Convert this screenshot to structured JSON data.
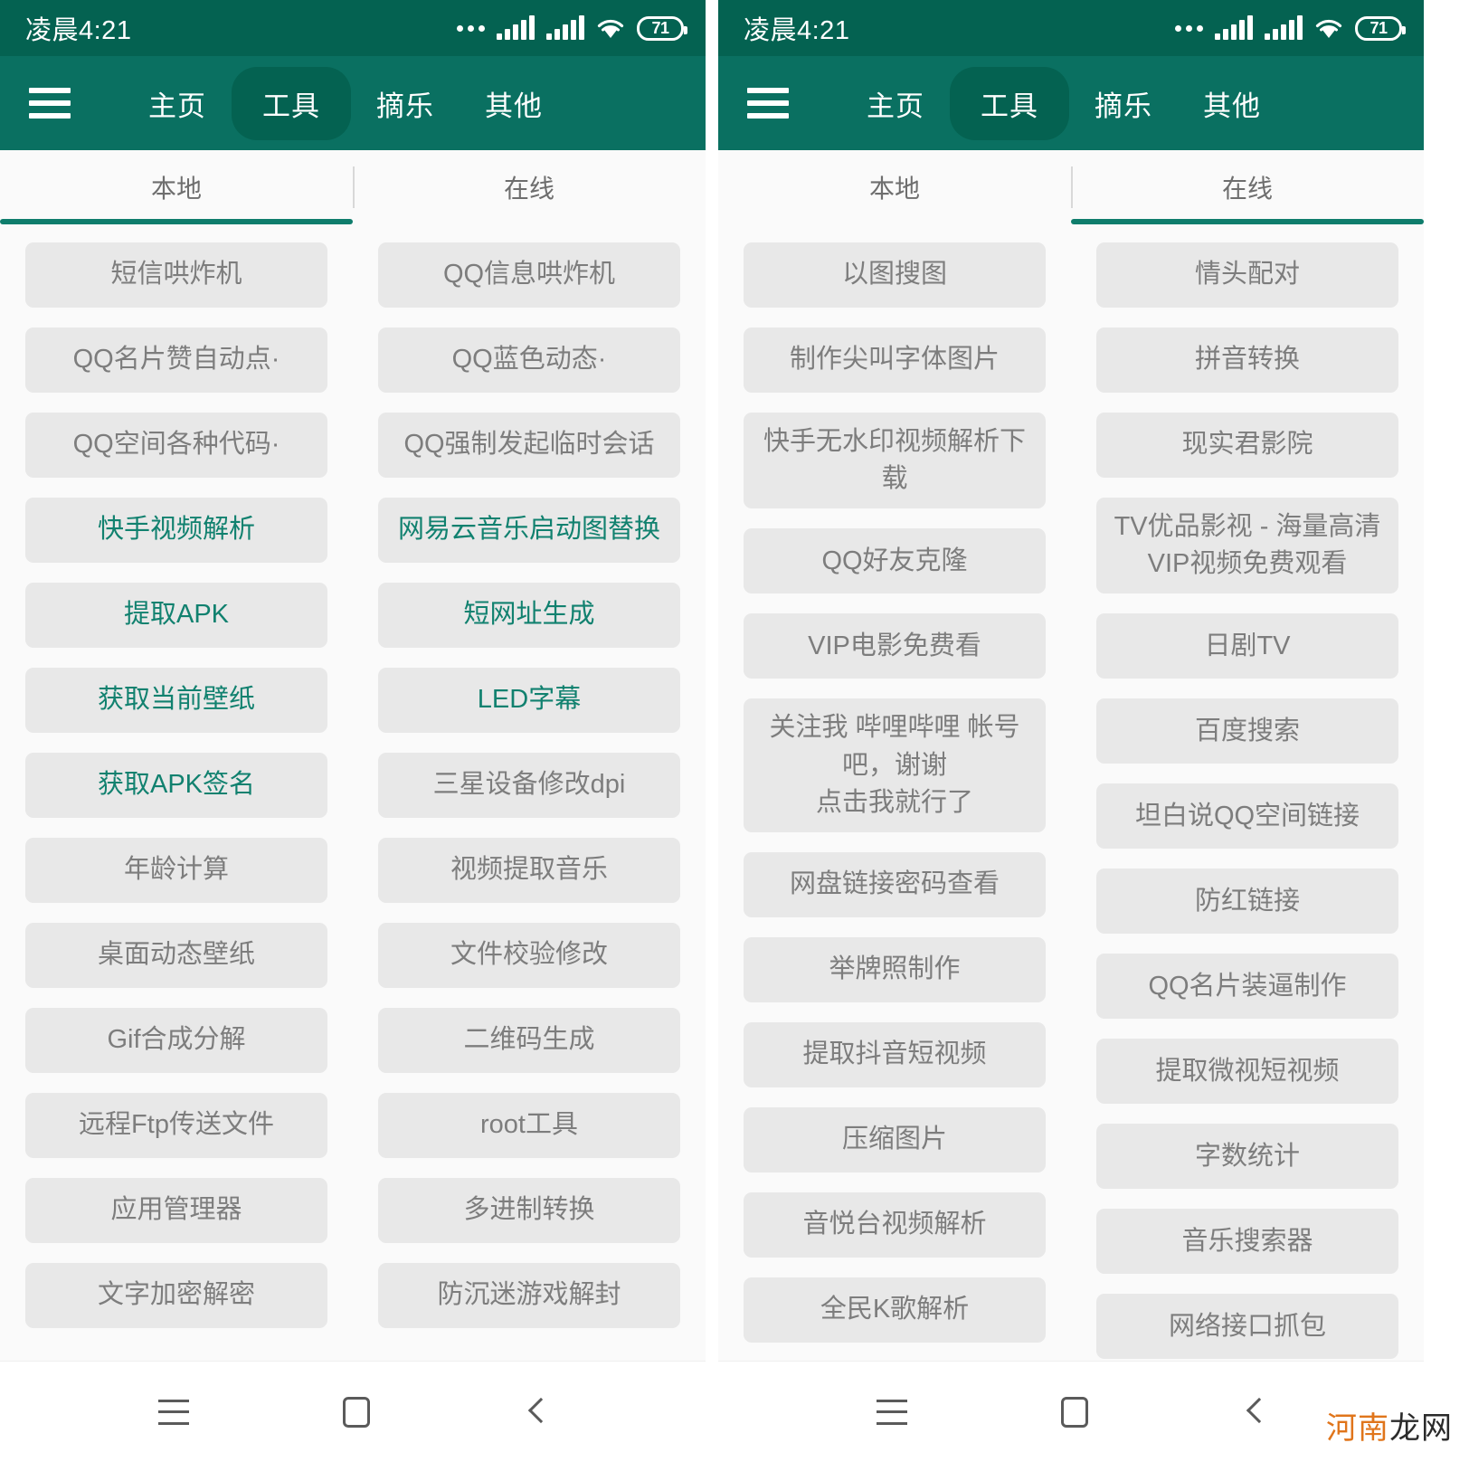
{
  "theme": {
    "statusbar_bg": "#046251",
    "appbar_bg": "#0a7061",
    "accent": "#11816f",
    "item_bg": "#e8e8e8",
    "item_text": "#7d7d7d",
    "page_bg": "#fafafa"
  },
  "statusbar": {
    "time": "凌晨4:21",
    "battery_level": "71",
    "icons": [
      "more-dots-icon",
      "signal-bars-icon",
      "signal-bars-icon",
      "wifi-icon",
      "battery-icon"
    ]
  },
  "appbar": {
    "menu_icon": "hamburger-menu-icon",
    "tabs": [
      {
        "label": "主页",
        "active": false
      },
      {
        "label": "工具",
        "active": true
      },
      {
        "label": "摘乐",
        "active": false
      },
      {
        "label": "其他",
        "active": false
      }
    ]
  },
  "segmented_tabs": [
    {
      "label": "本地"
    },
    {
      "label": "在线"
    }
  ],
  "navbar": {
    "recent_label": "recent-apps-icon",
    "home_label": "home-icon",
    "back_label": "back-icon"
  },
  "watermark": {
    "part1": "河南",
    "part2": "龙网"
  },
  "panels": [
    {
      "name": "left-phone",
      "active_segment": 0,
      "columns": [
        {
          "items": [
            {
              "label": "短信哄炸机",
              "accent": false
            },
            {
              "label": "QQ名片赞自动点·",
              "accent": false
            },
            {
              "label": "QQ空间各种代码·",
              "accent": false
            },
            {
              "label": "快手视频解析",
              "accent": true
            },
            {
              "label": "提取APK",
              "accent": true
            },
            {
              "label": "获取当前壁纸",
              "accent": true
            },
            {
              "label": "获取APK签名",
              "accent": true
            },
            {
              "label": "年龄计算",
              "accent": false
            },
            {
              "label": "桌面动态壁纸",
              "accent": false
            },
            {
              "label": "Gif合成分解",
              "accent": false
            },
            {
              "label": "远程Ftp传送文件",
              "accent": false
            },
            {
              "label": "应用管理器",
              "accent": false
            },
            {
              "label": "文字加密解密",
              "accent": false
            }
          ]
        },
        {
          "items": [
            {
              "label": "QQ信息哄炸机",
              "accent": false
            },
            {
              "label": "QQ蓝色动态·",
              "accent": false
            },
            {
              "label": "QQ强制发起临时会话",
              "accent": false
            },
            {
              "label": "网易云音乐启动图替换",
              "accent": true
            },
            {
              "label": "短网址生成",
              "accent": true
            },
            {
              "label": "LED字幕",
              "accent": true
            },
            {
              "label": "三星设备修改dpi",
              "accent": false
            },
            {
              "label": "视频提取音乐",
              "accent": false
            },
            {
              "label": "文件校验修改",
              "accent": false
            },
            {
              "label": "二维码生成",
              "accent": false
            },
            {
              "label": "root工具",
              "accent": false
            },
            {
              "label": "多进制转换",
              "accent": false
            },
            {
              "label": "防沉迷游戏解封",
              "accent": false
            }
          ]
        }
      ]
    },
    {
      "name": "right-phone",
      "active_segment": 1,
      "columns": [
        {
          "items": [
            {
              "label": "以图搜图",
              "accent": false
            },
            {
              "label": "制作尖叫字体图片",
              "accent": false
            },
            {
              "label": "快手无水印视频解析下载",
              "accent": false
            },
            {
              "label": "QQ好友克隆",
              "accent": false
            },
            {
              "label": "VIP电影免费看",
              "accent": false
            },
            {
              "label": "关注我 哔哩哔哩 帐号吧，谢谢\n点击我就行了",
              "accent": false
            },
            {
              "label": "网盘链接密码查看",
              "accent": false
            },
            {
              "label": "举牌照制作",
              "accent": false
            },
            {
              "label": "提取抖音短视频",
              "accent": false
            },
            {
              "label": "压缩图片",
              "accent": false
            },
            {
              "label": "音悦台视频解析",
              "accent": false
            },
            {
              "label": "全民K歌解析",
              "accent": false
            }
          ]
        },
        {
          "items": [
            {
              "label": "情头配对",
              "accent": false
            },
            {
              "label": "拼音转换",
              "accent": false
            },
            {
              "label": "现实君影院",
              "accent": false
            },
            {
              "label": "TV优品影视 - 海量高清VIP视频免费观看",
              "accent": false
            },
            {
              "label": "日剧TV",
              "accent": false
            },
            {
              "label": "百度搜索",
              "accent": false
            },
            {
              "label": "坦白说QQ空间链接",
              "accent": false
            },
            {
              "label": "防红链接",
              "accent": false
            },
            {
              "label": "QQ名片装逼制作",
              "accent": false
            },
            {
              "label": "提取微视短视频",
              "accent": false
            },
            {
              "label": "字数统计",
              "accent": false
            },
            {
              "label": "音乐搜索器",
              "accent": false
            },
            {
              "label": "网络接口抓包",
              "accent": false
            }
          ]
        }
      ]
    }
  ]
}
